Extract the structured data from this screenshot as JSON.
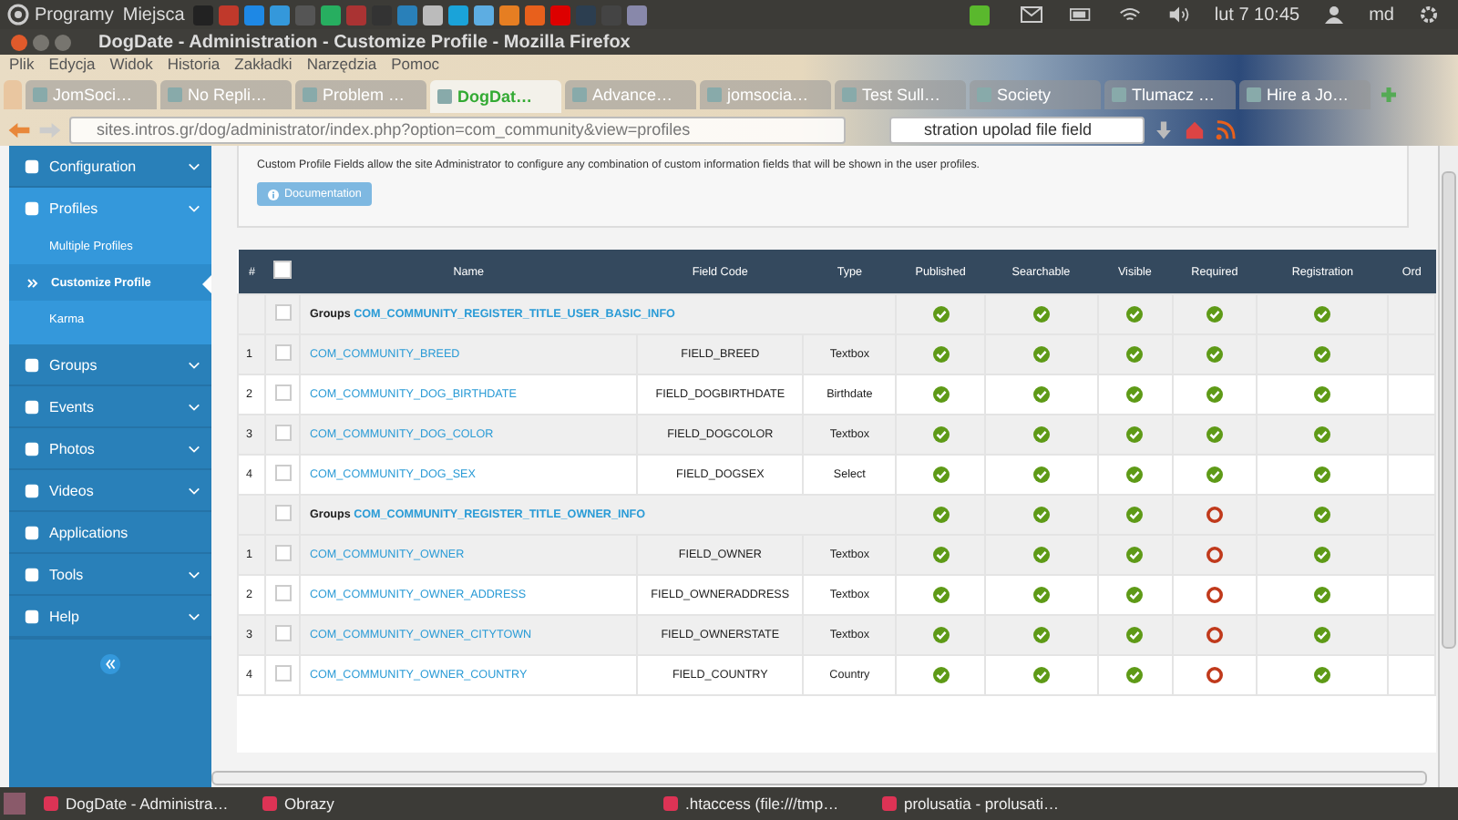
{
  "top_panel": {
    "menus": [
      "Programy",
      "Miejsca"
    ],
    "clock": "lut 7 10:45",
    "user": "md"
  },
  "window": {
    "title": "DogDate - Administration - Customize Profile - Mozilla Firefox"
  },
  "menu_bar": [
    "Plik",
    "Edycja",
    "Widok",
    "Historia",
    "Zakładki",
    "Narzędzia",
    "Pomoc"
  ],
  "tabs": [
    {
      "label": "JomSoci…",
      "selected": false
    },
    {
      "label": "No Repli…",
      "selected": false
    },
    {
      "label": "Problem …",
      "selected": false
    },
    {
      "label": "DogDat…",
      "selected": true
    },
    {
      "label": "Advance…",
      "selected": false
    },
    {
      "label": "jomsocia…",
      "selected": false
    },
    {
      "label": "Test Sull…",
      "selected": false
    },
    {
      "label": "Society",
      "selected": false
    },
    {
      "label": "Tlumacz …",
      "selected": false
    },
    {
      "label": "Hire a Jo…",
      "selected": false
    }
  ],
  "address_bar": {
    "url": "sites.intros.gr/dog/administrator/index.php?option=com_community&view=profiles"
  },
  "search": {
    "value": "stration upolad file field"
  },
  "sidebar": {
    "items": [
      {
        "label": "Configuration",
        "kind": "collapsible",
        "expanded": false
      },
      {
        "label": "Profiles",
        "kind": "collapsible",
        "expanded": true,
        "children": [
          {
            "label": "Multiple Profiles",
            "selected": false
          },
          {
            "label": "Customize Profile",
            "selected": true
          },
          {
            "label": "Karma",
            "selected": false
          }
        ]
      },
      {
        "label": "Groups",
        "kind": "collapsible",
        "expanded": false
      },
      {
        "label": "Events",
        "kind": "collapsible",
        "expanded": false
      },
      {
        "label": "Photos",
        "kind": "collapsible",
        "expanded": false
      },
      {
        "label": "Videos",
        "kind": "collapsible",
        "expanded": false
      },
      {
        "label": "Applications",
        "kind": "link",
        "expanded": false
      },
      {
        "label": "Tools",
        "kind": "collapsible",
        "expanded": false
      },
      {
        "label": "Help",
        "kind": "collapsible",
        "expanded": false
      }
    ]
  },
  "intro": {
    "text": "Custom Profile Fields allow the site Administrator to configure any combination of custom information fields that will be shown in the user profiles.",
    "button": "Documentation"
  },
  "table": {
    "select_all_checked": false,
    "columns": [
      "#",
      "Name",
      "Field Code",
      "Type",
      "Published",
      "Searchable",
      "Visible",
      "Required",
      "Registration",
      "Ord"
    ],
    "groups": [
      {
        "prefix": "Groups",
        "checked": false,
        "name": "COM_COMMUNITY_REGISTER_TITLE_USER_BASIC_INFO",
        "flags": [
          true,
          true,
          true,
          true,
          true
        ],
        "fields": [
          {
            "number": "1",
            "checked": false,
            "name": "COM_COMMUNITY_BREED",
            "code": "FIELD_BREED",
            "type": "Textbox",
            "flags": [
              true,
              true,
              true,
              true,
              true
            ]
          },
          {
            "number": "2",
            "checked": false,
            "name": "COM_COMMUNITY_DOG_BIRTHDATE",
            "code": "FIELD_DOGBIRTHDATE",
            "type": "Birthdate",
            "flags": [
              true,
              true,
              true,
              true,
              true
            ]
          },
          {
            "number": "3",
            "checked": false,
            "name": "COM_COMMUNITY_DOG_COLOR",
            "code": "FIELD_DOGCOLOR",
            "type": "Textbox",
            "flags": [
              true,
              true,
              true,
              true,
              true
            ]
          },
          {
            "number": "4",
            "checked": false,
            "name": "COM_COMMUNITY_DOG_SEX",
            "code": "FIELD_DOGSEX",
            "type": "Select",
            "flags": [
              true,
              true,
              true,
              true,
              true
            ]
          }
        ]
      },
      {
        "prefix": "Groups",
        "checked": false,
        "name": "COM_COMMUNITY_REGISTER_TITLE_OWNER_INFO",
        "flags": [
          true,
          true,
          true,
          false,
          true
        ],
        "fields": [
          {
            "number": "1",
            "checked": false,
            "name": "COM_COMMUNITY_OWNER",
            "code": "FIELD_OWNER",
            "type": "Textbox",
            "flags": [
              true,
              true,
              true,
              false,
              true
            ]
          },
          {
            "number": "2",
            "checked": false,
            "name": "COM_COMMUNITY_OWNER_ADDRESS",
            "code": "FIELD_OWNERADDRESS",
            "type": "Textbox",
            "flags": [
              true,
              true,
              true,
              false,
              true
            ]
          },
          {
            "number": "3",
            "checked": false,
            "name": "COM_COMMUNITY_OWNER_CITYTOWN",
            "code": "FIELD_OWNERSTATE",
            "type": "Textbox",
            "flags": [
              true,
              true,
              true,
              false,
              true
            ]
          },
          {
            "number": "4",
            "checked": false,
            "name": "COM_COMMUNITY_OWNER_COUNTRY",
            "code": "FIELD_COUNTRY",
            "type": "Country",
            "flags": [
              true,
              true,
              true,
              false,
              true
            ]
          }
        ]
      }
    ]
  },
  "taskbar": [
    "DogDate - Administra…",
    "Obrazy",
    ".htaccess (file:///tmp…",
    "prolusatia - prolusati…"
  ]
}
